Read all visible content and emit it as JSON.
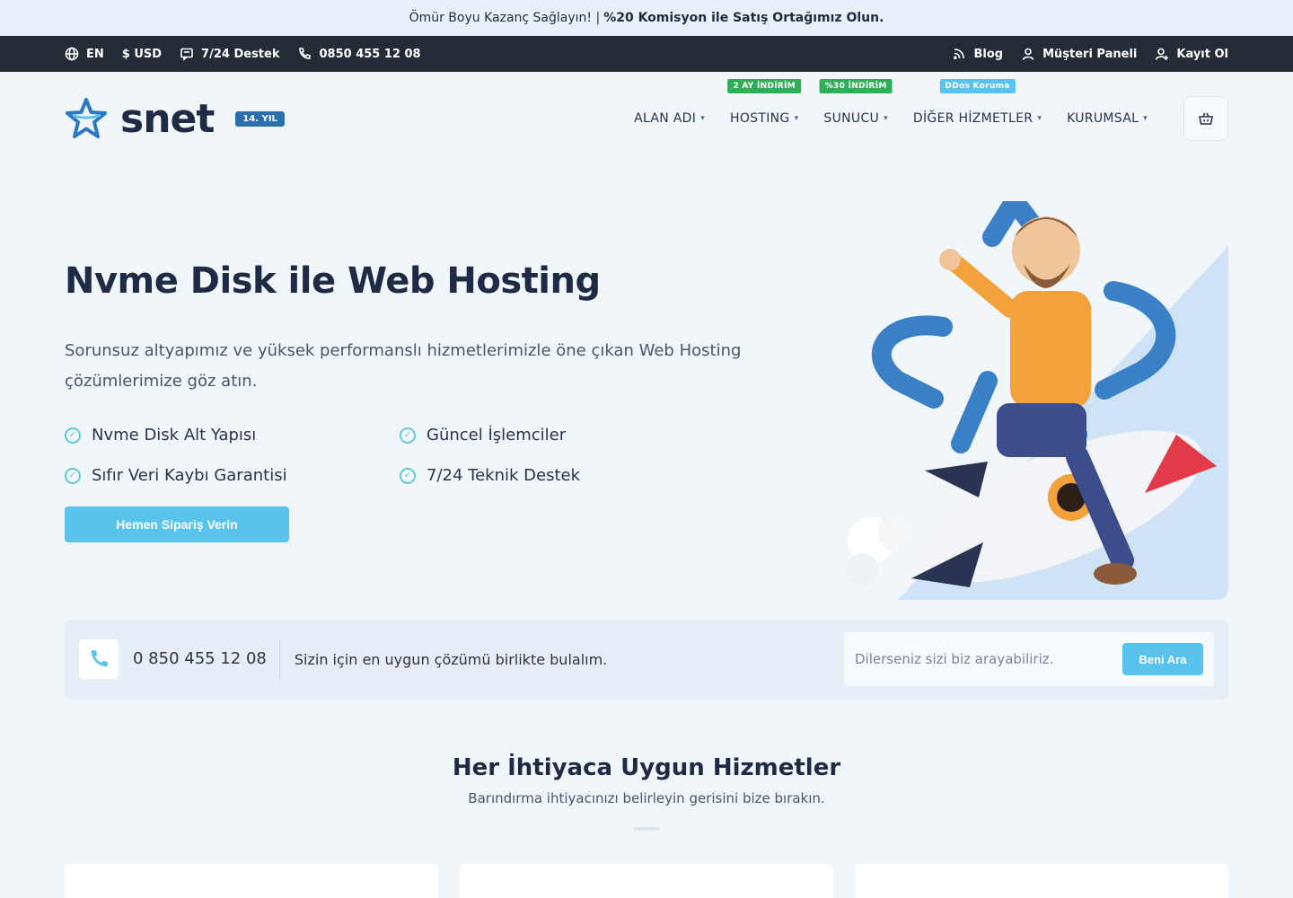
{
  "promo": {
    "text": "Ömür Boyu Kazanç Sağlayın! |",
    "bold": "%20 Komisyon ile Satış Ortağımız Olun."
  },
  "topbar": {
    "lang": "EN",
    "currency": "$ USD",
    "support": "7/24 Destek",
    "phone": "0850 455 12 08",
    "blog": "Blog",
    "client_panel": "Müşteri Paneli",
    "register": "Kayıt Ol"
  },
  "logo": {
    "text": "snet",
    "year_badge": "14. YIL"
  },
  "nav": [
    {
      "label": "ALAN ADI",
      "badge": ""
    },
    {
      "label": "HOSTING",
      "badge": "2 AY İNDİRİM"
    },
    {
      "label": "SUNUCU",
      "badge": "%30 İNDİRİM"
    },
    {
      "label": "DİĞER HİZMETLER",
      "badge": "DDos Koruma"
    },
    {
      "label": "KURUMSAL",
      "badge": ""
    }
  ],
  "colors": {
    "badge_green": "#2fae58",
    "badge_blue": "#58c3ec",
    "accent": "#58c3ec",
    "dark": "#232b36"
  },
  "hero": {
    "title": "Nvme Disk ile Web Hosting",
    "description": "Sorunsuz altyapımız ve yüksek performanslı hizmetlerimizle öne çıkan Web Hosting çözümlerimize göz atın.",
    "features": [
      "Nvme Disk Alt Yapısı",
      "Güncel İşlemciler",
      "Sıfır Veri Kaybı Garantisi",
      "7/24 Teknik Destek"
    ],
    "cta": "Hemen Sipariş Verin"
  },
  "callbar": {
    "phone": "0 850 455 12 08",
    "message": "Sizin için en uygun çözümü birlikte bulalım.",
    "placeholder": "Dilerseniz sizi biz arayabiliriz.",
    "button": "Beni Ara"
  },
  "services": {
    "title": "Her İhtiyaca Uygun Hizmetler",
    "subtitle": "Barındırma ihtiyacınızı belirleyin gerisini bize bırakın."
  }
}
